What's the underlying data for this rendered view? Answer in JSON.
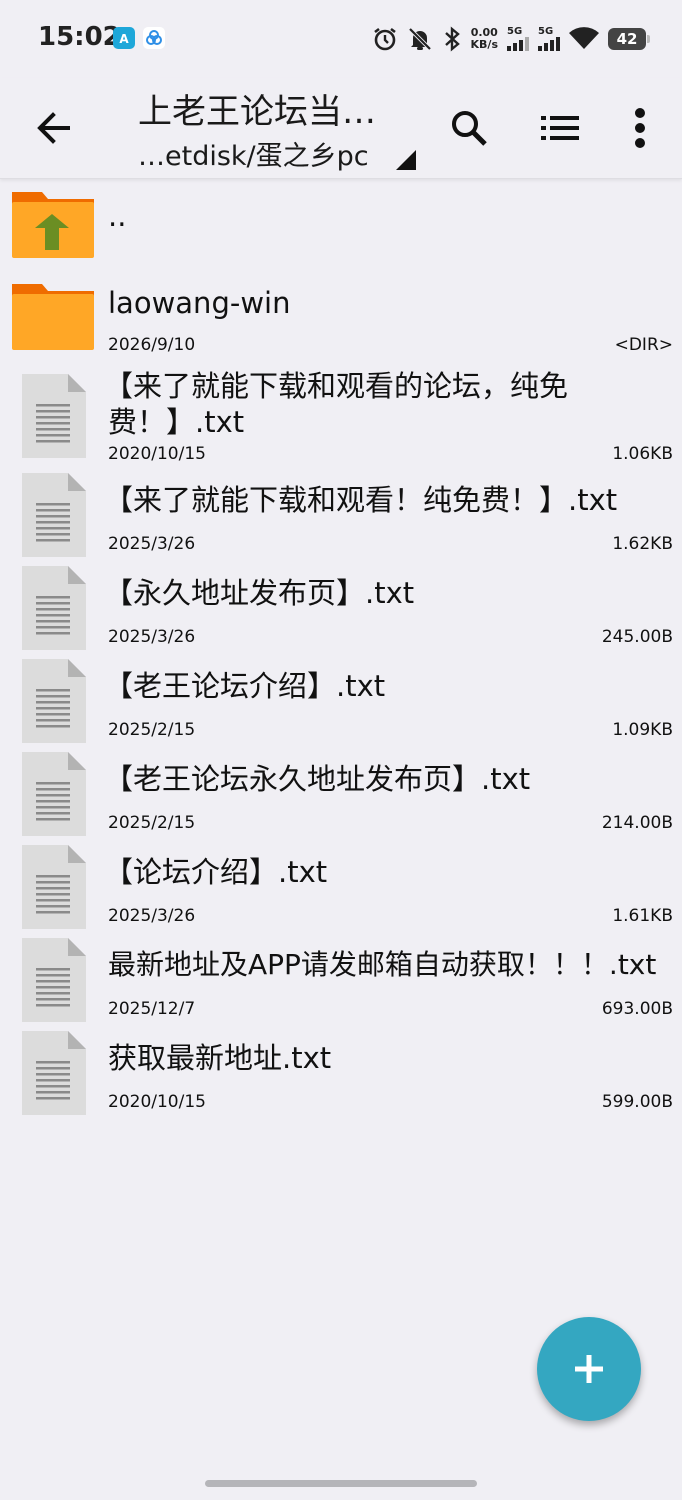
{
  "statusbar": {
    "time": "15:02",
    "net_speed_value": "0.00",
    "net_speed_unit": "KB/s",
    "sim1": "5G",
    "sim2": "5G",
    "battery": "42",
    "icons": [
      "alarm-icon",
      "mute-icon",
      "bluetooth-icon",
      "signal-icon",
      "wifi-icon",
      "battery-icon"
    ]
  },
  "toolbar": {
    "title": "上老王论坛当…",
    "path": "…etdisk/蛋之乡pc",
    "icons": [
      "back-arrow-icon",
      "search-icon",
      "list-view-icon",
      "more-vert-icon"
    ]
  },
  "files": [
    {
      "name": "..",
      "date": "",
      "size": "",
      "type": "parent-folder"
    },
    {
      "name": "laowang-win",
      "date": "2026/9/10",
      "size": "<DIR>",
      "type": "folder"
    },
    {
      "name": "【来了就能下载和观看的论坛，纯免费！】.txt",
      "name_line1": "【来了就能下载和观看的论坛，纯免",
      "name_line2": "费！】.txt",
      "date": "2020/10/15",
      "size": "1.06KB",
      "type": "file"
    },
    {
      "name": "【来了就能下载和观看！纯免费！】.txt",
      "date": "2025/3/26",
      "size": "1.62KB",
      "type": "file"
    },
    {
      "name": "【永久地址发布页】.txt",
      "date": "2025/3/26",
      "size": "245.00B",
      "type": "file"
    },
    {
      "name": "【老王论坛介绍】.txt",
      "date": "2025/2/15",
      "size": "1.09KB",
      "type": "file"
    },
    {
      "name": "【老王论坛永久地址发布页】.txt",
      "date": "2025/2/15",
      "size": "214.00B",
      "type": "file"
    },
    {
      "name": "【论坛介绍】.txt",
      "date": "2025/3/26",
      "size": "1.61KB",
      "type": "file"
    },
    {
      "name": "最新地址及APP请发邮箱自动获取！！！.txt",
      "date": "2025/12/7",
      "size": "693.00B",
      "type": "file"
    },
    {
      "name": "获取最新地址.txt",
      "date": "2020/10/15",
      "size": "599.00B",
      "type": "file"
    }
  ],
  "colors": {
    "folder": "#ffa726",
    "folder_tab": "#ef6c00",
    "up_arrow": "#6b8e23",
    "fab": "#34a7c1",
    "background": "#f0eff4"
  },
  "fab": {
    "icon": "plus-icon"
  }
}
